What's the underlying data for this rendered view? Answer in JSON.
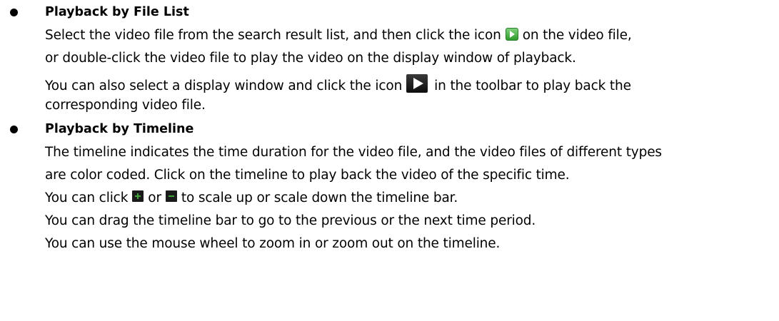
{
  "section_file_list": {
    "heading": "Playback by File List",
    "line1_pre": "Select the video file from the search result list, and then click the icon",
    "line1_post": "on the video file,",
    "line2": "or double-click the video file to play the video on the display window of playback.",
    "line3_pre": "You can also select a display window and click the icon",
    "line3_post": "in the toolbar to play back the",
    "line4": "corresponding video file."
  },
  "section_timeline": {
    "heading": "Playback by Timeline",
    "line1": "The timeline indicates the time duration for the video file, and the video files of different types",
    "line2": "are color coded. Click on the timeline to play back the video of the specific time.",
    "line3_pre": "You can click",
    "line3_mid": "or",
    "line3_post": "to scale up or scale down the timeline bar.",
    "line4": "You can drag the timeline bar to go to the previous or the next time period.",
    "line5": "You can use the mouse wheel to zoom in or zoom out on the timeline."
  },
  "icons": {
    "play_small": "play-small-icon",
    "play_large": "play-large-icon",
    "plus": "plus-icon",
    "minus": "minus-icon"
  }
}
